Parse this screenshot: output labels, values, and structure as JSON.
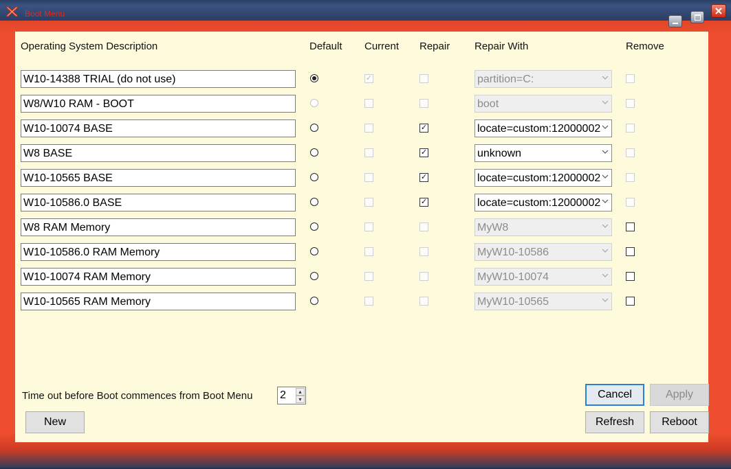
{
  "window": {
    "title": "Boot Menu",
    "colors": {
      "frame": "#ee4e2f",
      "client": "#fdfbdc",
      "title_text": "#e4281b"
    }
  },
  "headers": {
    "description": "Operating System Description",
    "default": "Default",
    "current": "Current",
    "repair": "Repair",
    "repair_with": "Repair With",
    "remove": "Remove"
  },
  "entries": [
    {
      "description": "W10-14388 TRIAL (do not use)",
      "default": true,
      "default_enabled": true,
      "current": true,
      "current_enabled": false,
      "repair": false,
      "repair_enabled": false,
      "repair_with": "partition=C:",
      "repair_with_enabled": false,
      "remove": false,
      "remove_enabled": false
    },
    {
      "description": "W8/W10 RAM - BOOT",
      "default": false,
      "default_enabled": false,
      "current": false,
      "current_enabled": false,
      "repair": false,
      "repair_enabled": false,
      "repair_with": "boot",
      "repair_with_enabled": false,
      "remove": false,
      "remove_enabled": false
    },
    {
      "description": "W10-10074 BASE",
      "default": false,
      "default_enabled": true,
      "current": false,
      "current_enabled": false,
      "repair": true,
      "repair_enabled": true,
      "repair_with": "locate=custom:12000002",
      "repair_with_enabled": true,
      "remove": false,
      "remove_enabled": false
    },
    {
      "description": "W8 BASE",
      "default": false,
      "default_enabled": true,
      "current": false,
      "current_enabled": false,
      "repair": true,
      "repair_enabled": true,
      "repair_with": "unknown",
      "repair_with_enabled": true,
      "remove": false,
      "remove_enabled": false
    },
    {
      "description": "W10-10565 BASE",
      "default": false,
      "default_enabled": true,
      "current": false,
      "current_enabled": false,
      "repair": true,
      "repair_enabled": true,
      "repair_with": "locate=custom:12000002",
      "repair_with_enabled": true,
      "remove": false,
      "remove_enabled": false
    },
    {
      "description": "W10-10586.0 BASE",
      "default": false,
      "default_enabled": true,
      "current": false,
      "current_enabled": false,
      "repair": true,
      "repair_enabled": true,
      "repair_with": "locate=custom:12000002",
      "repair_with_enabled": true,
      "remove": false,
      "remove_enabled": false
    },
    {
      "description": "W8 RAM Memory",
      "default": false,
      "default_enabled": true,
      "current": false,
      "current_enabled": false,
      "repair": false,
      "repair_enabled": false,
      "repair_with": "MyW8",
      "repair_with_enabled": false,
      "remove": false,
      "remove_enabled": true
    },
    {
      "description": "W10-10586.0 RAM Memory",
      "default": false,
      "default_enabled": true,
      "current": false,
      "current_enabled": false,
      "repair": false,
      "repair_enabled": false,
      "repair_with": "MyW10-10586",
      "repair_with_enabled": false,
      "remove": false,
      "remove_enabled": true
    },
    {
      "description": "W10-10074 RAM Memory",
      "default": false,
      "default_enabled": true,
      "current": false,
      "current_enabled": false,
      "repair": false,
      "repair_enabled": false,
      "repair_with": "MyW10-10074",
      "repair_with_enabled": false,
      "remove": false,
      "remove_enabled": true
    },
    {
      "description": "W10-10565 RAM Memory",
      "default": false,
      "default_enabled": true,
      "current": false,
      "current_enabled": false,
      "repair": false,
      "repair_enabled": false,
      "repair_with": "MyW10-10565",
      "repair_with_enabled": false,
      "remove": false,
      "remove_enabled": true
    }
  ],
  "footer": {
    "timeout_label": "Time out before Boot commences from Boot Menu",
    "timeout_value": "2",
    "buttons": {
      "new": "New",
      "cancel": "Cancel",
      "apply": "Apply",
      "refresh": "Refresh",
      "reboot": "Reboot"
    }
  }
}
